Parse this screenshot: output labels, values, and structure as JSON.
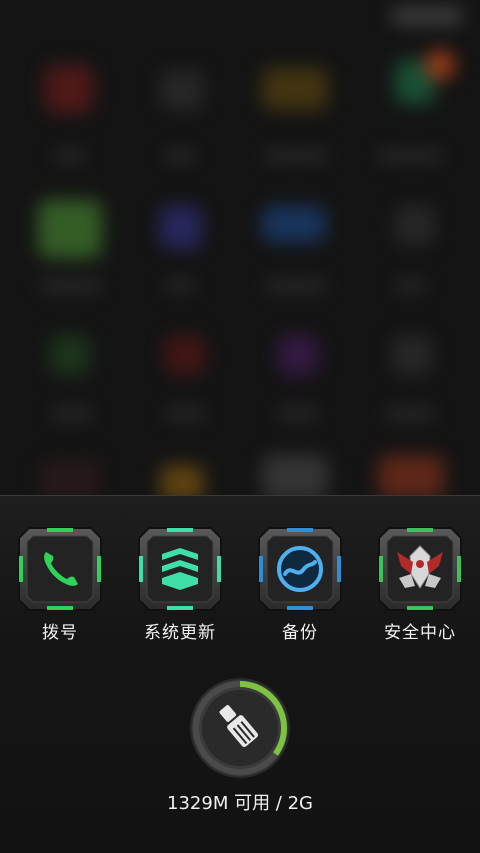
{
  "recent_apps": [
    {
      "label": "拨号",
      "icon": "phone-icon",
      "accent": "#2fd35a"
    },
    {
      "label": "系统更新",
      "icon": "system-update-icon",
      "accent": "#3fe0a8"
    },
    {
      "label": "备份",
      "icon": "backup-icon",
      "accent": "#2f8fd6"
    },
    {
      "label": "安全中心",
      "icon": "security-center-icon",
      "accent": "#3cc25a"
    }
  ],
  "memory": {
    "text": "1329M 可用 / 2G",
    "used_fraction": 0.35,
    "ring_color": "#7dc241"
  },
  "cleaner_button": {
    "icon": "broom-icon"
  }
}
